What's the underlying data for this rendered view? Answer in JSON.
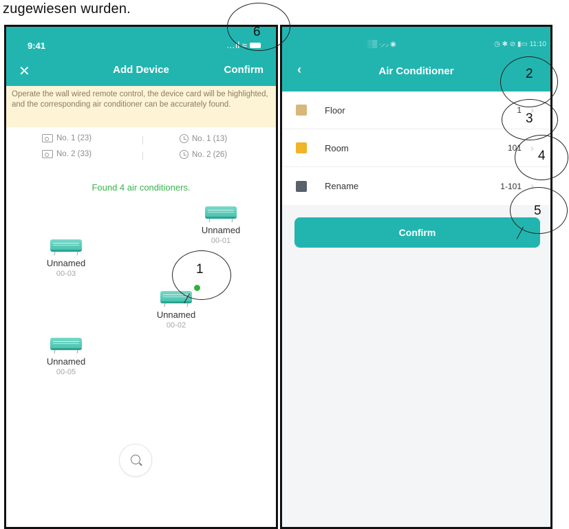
{
  "caption": "zugewiesen wurden.",
  "left_phone": {
    "status_time": "9:41",
    "status_signal": "…ıl ≈",
    "close_icon": "✕",
    "title": "Add Device",
    "confirm": "Confirm",
    "notice": "Operate the wall wired remote control, the device card will be highlighted, and the corresponding air conditioner can be accurately found.",
    "stats": [
      {
        "icon": "remote-icon",
        "label": "No. 1 (23)"
      },
      {
        "icon": "clock-icon",
        "label": "No. 1 (13)"
      },
      {
        "icon": "remote-icon",
        "label": "No. 2 (33)"
      },
      {
        "icon": "clock-icon",
        "label": "No. 2 (26)"
      }
    ],
    "found_text": "Found 4 air conditioners.",
    "devices": [
      {
        "name": "Unnamed",
        "code": "00-01"
      },
      {
        "name": "Unnamed",
        "code": "00-03"
      },
      {
        "name": "Unnamed",
        "code": "00-02"
      },
      {
        "name": "Unnamed",
        "code": "00-05"
      }
    ]
  },
  "right_phone": {
    "status_left": "░▒ ∙◞∙◞ ◉",
    "status_right": "◷ ✱ ⊘ ▮▭ 11:10",
    "back_icon": "‹",
    "title": "Air Conditioner",
    "rows": [
      {
        "label": "Floor",
        "value": "1"
      },
      {
        "label": "Room",
        "value": "101"
      },
      {
        "label": "Rename",
        "value": "1-101"
      }
    ],
    "chevron": "›",
    "confirm": "Confirm"
  },
  "callouts": [
    "1",
    "2",
    "3",
    "4",
    "5",
    "6"
  ],
  "colors": {
    "teal": "#22b5b0",
    "notice_bg": "#fdf3d5",
    "found_green": "#37b34a",
    "active_dot": "#2fb33a"
  }
}
